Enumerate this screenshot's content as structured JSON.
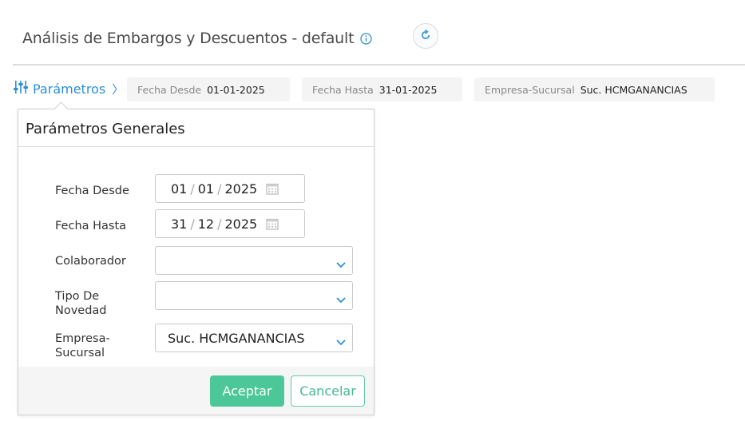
{
  "header": {
    "title": "Análisis de Embargos y Descuentos - default",
    "info_icon": "info-circle-icon",
    "refresh_icon": "refresh-icon"
  },
  "params_toggle": {
    "label": "Parámetros",
    "icon": "sliders-icon",
    "chevron": "〉"
  },
  "chips": [
    {
      "key": "Fecha Desde",
      "value": "01-01-2025"
    },
    {
      "key": "Fecha Hasta",
      "value": "31-01-2025"
    },
    {
      "key": "Empresa-Sucursal",
      "value": "Suc. HCMGANANCIAS"
    }
  ],
  "panel": {
    "title": "Parámetros Generales",
    "fields": {
      "fecha_desde": {
        "label": "Fecha Desde",
        "day": "01",
        "month": "01",
        "year": "2025"
      },
      "fecha_hasta": {
        "label": "Fecha Hasta",
        "day": "31",
        "month": "12",
        "year": "2025"
      },
      "colaborador": {
        "label": "Colaborador",
        "value": ""
      },
      "tipo_novedad": {
        "label_line1": "Tipo De",
        "label_line2": "Novedad",
        "value": ""
      },
      "empresa_sucursal": {
        "label_line1": "Empresa-",
        "label_line2": "Sucursal",
        "value": "Suc. HCMGANANCIAS"
      }
    },
    "buttons": {
      "accept": "Aceptar",
      "cancel": "Cancelar"
    }
  },
  "colors": {
    "accent_blue": "#2a8fd9",
    "accept_green": "#4cc79a"
  }
}
